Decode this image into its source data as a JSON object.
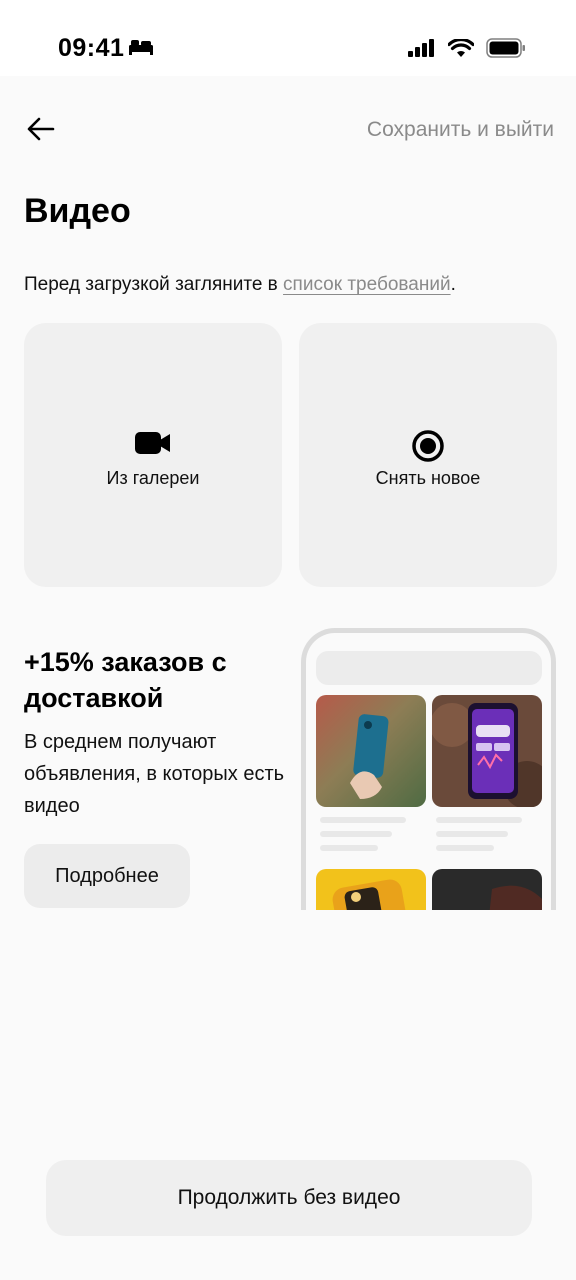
{
  "status_bar": {
    "time": "09:41"
  },
  "header": {
    "back_icon": "arrow-left-icon",
    "save_exit_label": "Сохранить и выйти"
  },
  "page": {
    "title": "Видео",
    "requirements_prefix": "Перед загрузкой загляните в ",
    "requirements_link": "список требований",
    "requirements_suffix": "."
  },
  "tiles": {
    "gallery": {
      "label": "Из галереи",
      "icon": "video-camera-icon"
    },
    "record": {
      "label": "Снять новое",
      "icon": "record-icon"
    }
  },
  "promo": {
    "title": "+15% заказов с доставкой",
    "text": "В среднем получают объявления, в которых есть видео",
    "more_label": "Подробнее"
  },
  "footer": {
    "continue_label": "Продолжить без видео"
  },
  "colors": {
    "background": "#fafafa",
    "tile": "#f0f0f0",
    "muted_text": "#8a8a8a",
    "button": "#efefef"
  }
}
